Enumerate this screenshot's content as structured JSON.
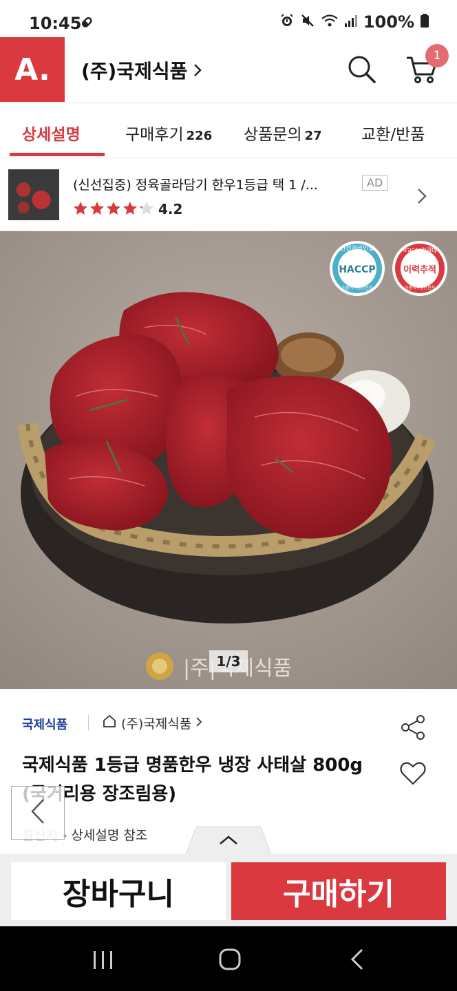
{
  "status_bar": {
    "time": "10:45",
    "battery": "100%",
    "icons": [
      "clip-icon",
      "alarm-icon",
      "mute-icon",
      "wifi-icon",
      "signal-icon",
      "battery-icon"
    ]
  },
  "header": {
    "logo": "A.",
    "store_name": "(주)국제식품",
    "cart_count": "1",
    "brand_color": "#d9393f"
  },
  "tabs": [
    {
      "label": "상세설명",
      "count": "",
      "active": true
    },
    {
      "label": "구매후기",
      "count": "226",
      "active": false
    },
    {
      "label": "상품문의",
      "count": "27",
      "active": false
    },
    {
      "label": "교환/반품",
      "count": "",
      "active": false
    }
  ],
  "ad": {
    "title": "(신선집중) 정육골라담기 한우1등급 택 1 /...",
    "tag": "AD",
    "rating": "4.2",
    "stars": 4.2
  },
  "hero": {
    "pager": "1/3",
    "watermark": "|주|국제식품",
    "badges": [
      {
        "top": "안전관리인증",
        "main": "HACCP",
        "bottom": "식품의약품안전처"
      },
      {
        "top": "Traceability",
        "main": "이력추적",
        "bottom": "식품의약품안전처"
      }
    ]
  },
  "product": {
    "brand": "국제식품",
    "seller": "(주)국제식품",
    "title": "국제식품 1등급 명품한우 냉장 사태살 800g(국거리용 장조림용)",
    "origin_label": "원산지",
    "origin_value": " - 상세설명 참조"
  },
  "actions": {
    "cart_label": "장바구니",
    "buy_label": "구매하기"
  }
}
